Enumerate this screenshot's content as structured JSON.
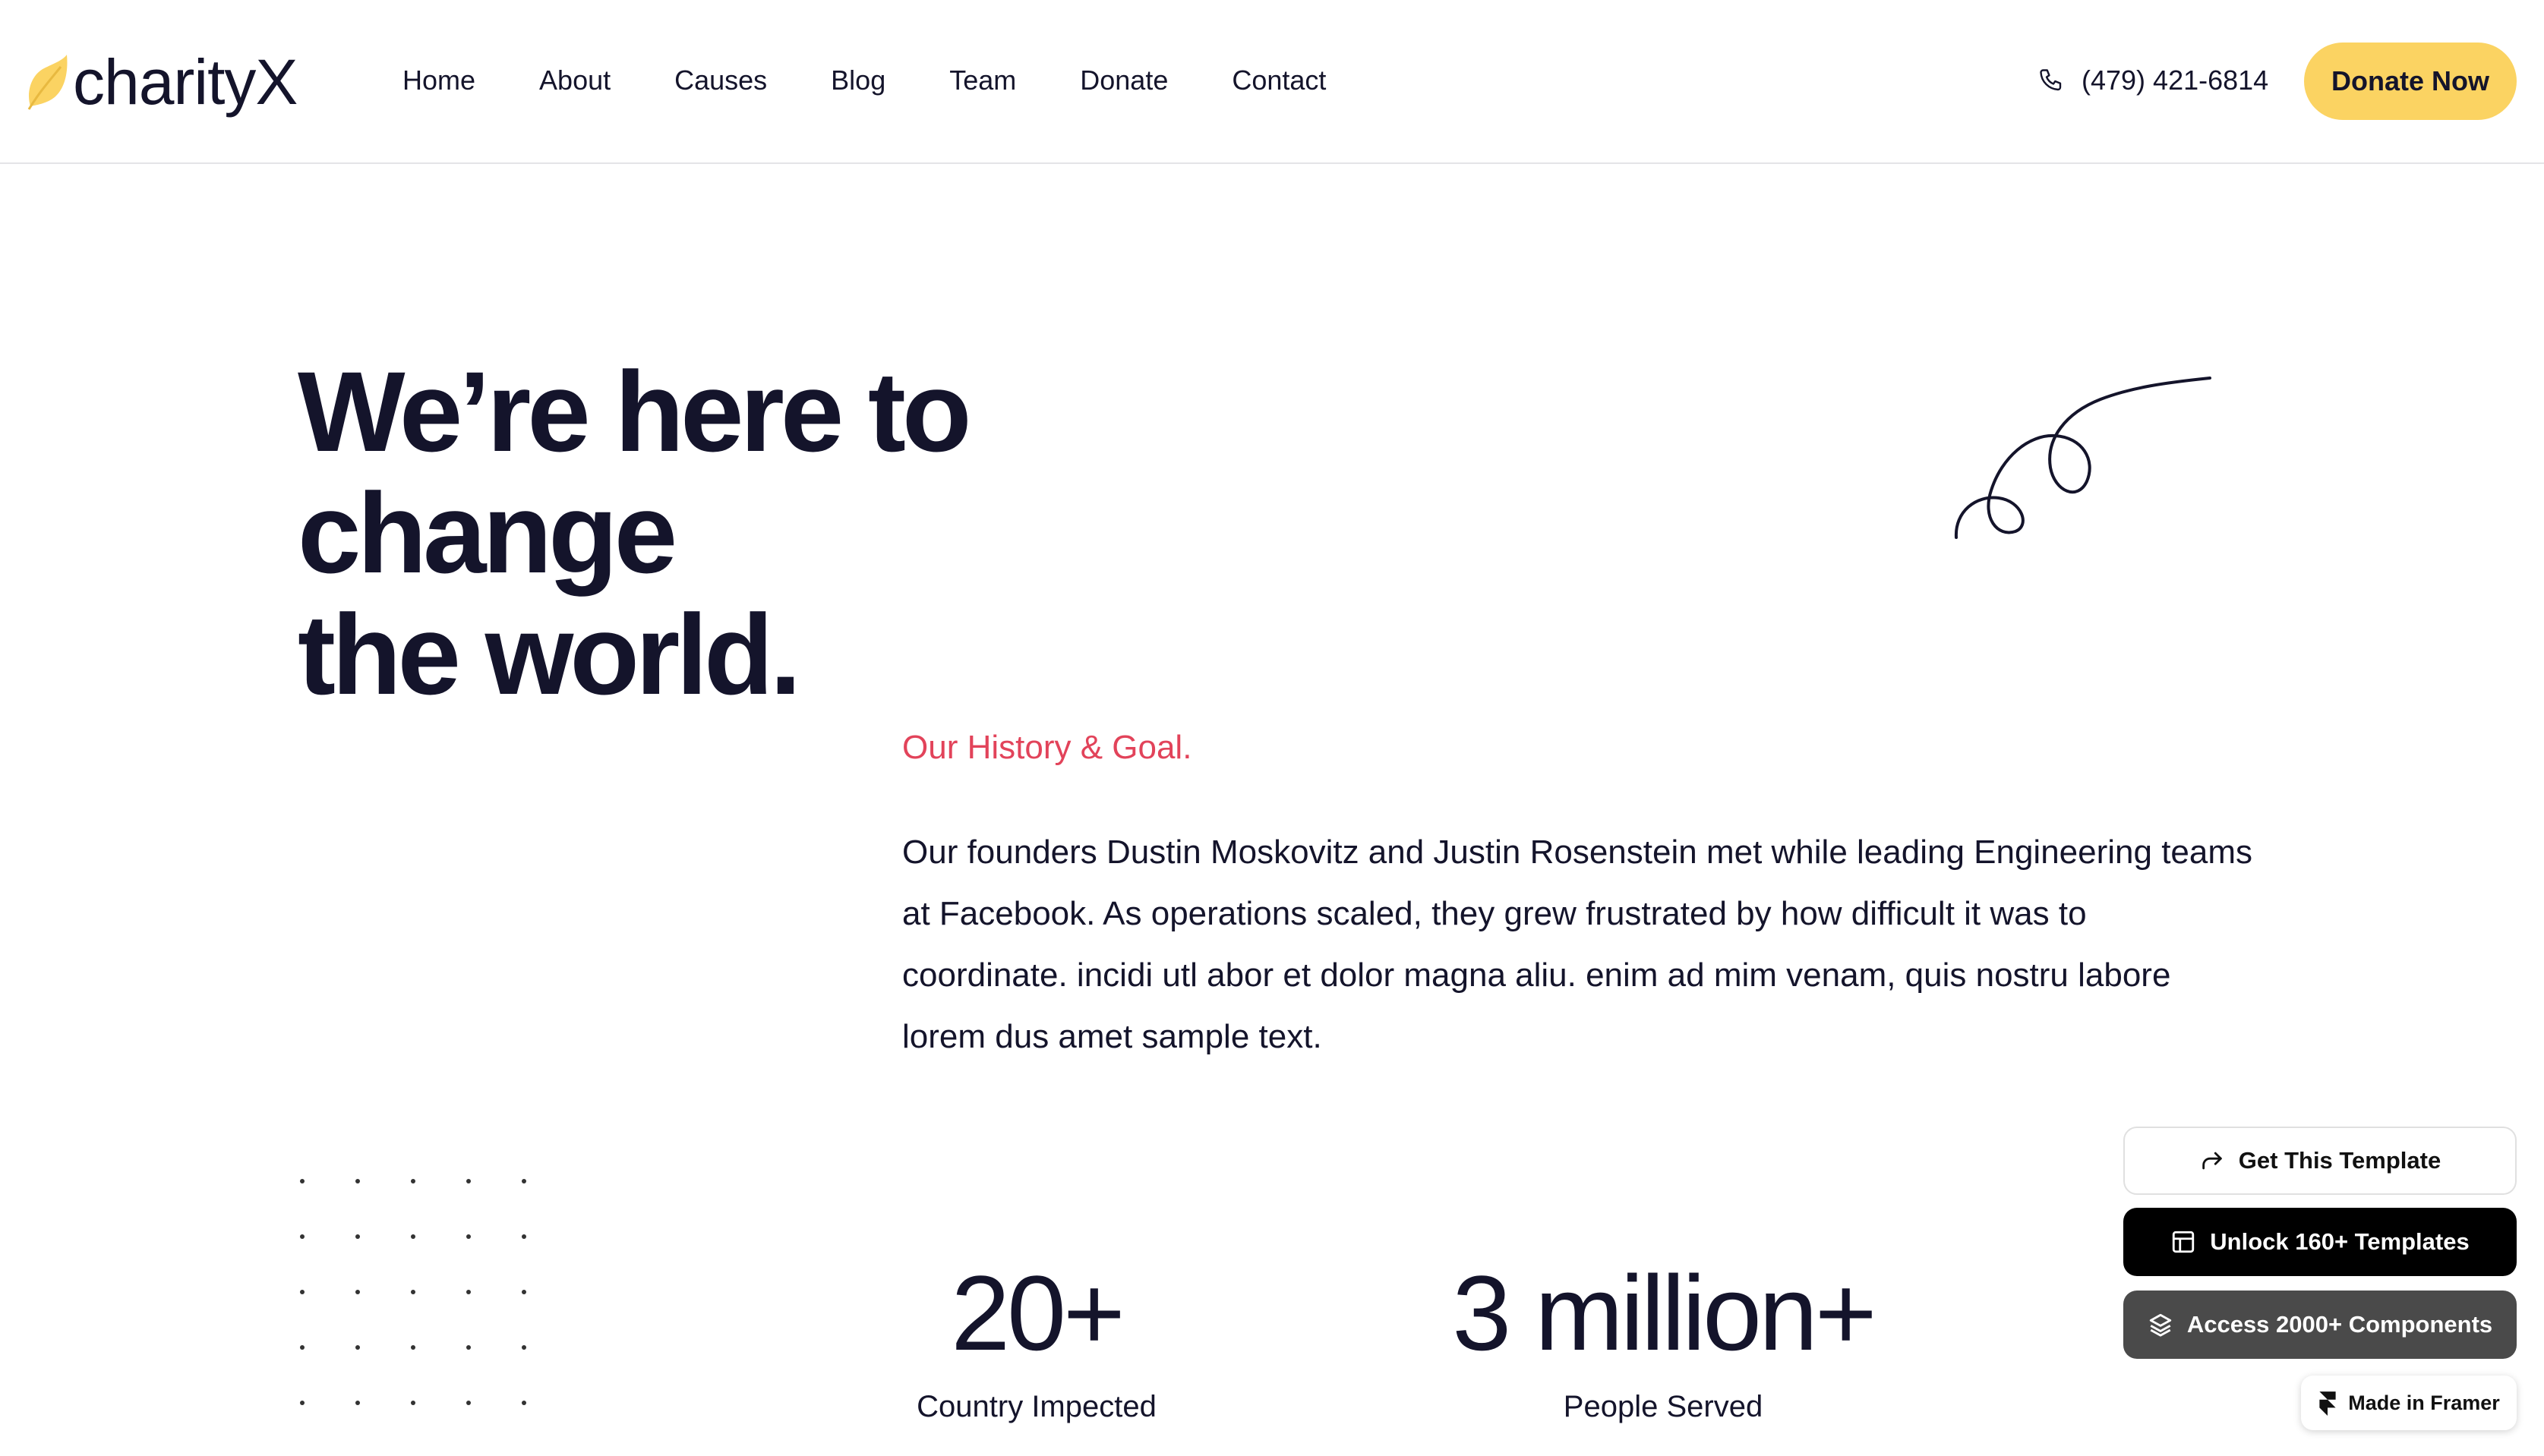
{
  "header": {
    "brand": "charityX",
    "nav": [
      {
        "label": "Home"
      },
      {
        "label": "About"
      },
      {
        "label": "Causes"
      },
      {
        "label": "Blog"
      },
      {
        "label": "Team"
      },
      {
        "label": "Donate"
      },
      {
        "label": "Contact"
      }
    ],
    "phone": "(479) 421-6814",
    "phone_icon": "phone-icon",
    "cta_label": "Donate Now"
  },
  "hero": {
    "title_line1": "We’re here to change",
    "title_line2": "the world."
  },
  "history": {
    "label": "Our History & Goal.",
    "body": "Our founders Dustin Moskovitz and Justin Rosenstein met while leading Engineering teams at Facebook. As operations scaled, they grew frustrated by how difficult it was to coordinate. incidi utl abor et dolor magna aliu.  enim ad mim venam, quis nostru labore lorem dus amet sample text."
  },
  "stats": [
    {
      "value": "20+",
      "label": "Country Impected"
    },
    {
      "value": "3 million+",
      "label": "People Served"
    }
  ],
  "framer_widget": {
    "get_template": "Get This Template",
    "unlock_templates": "Unlock 160+ Templates",
    "access_components": "Access 2000+ Components",
    "made_in": "Made in Framer"
  },
  "colors": {
    "accent_yellow": "#fbd362",
    "text_dark": "#14142b",
    "label_red": "#e2435a"
  }
}
